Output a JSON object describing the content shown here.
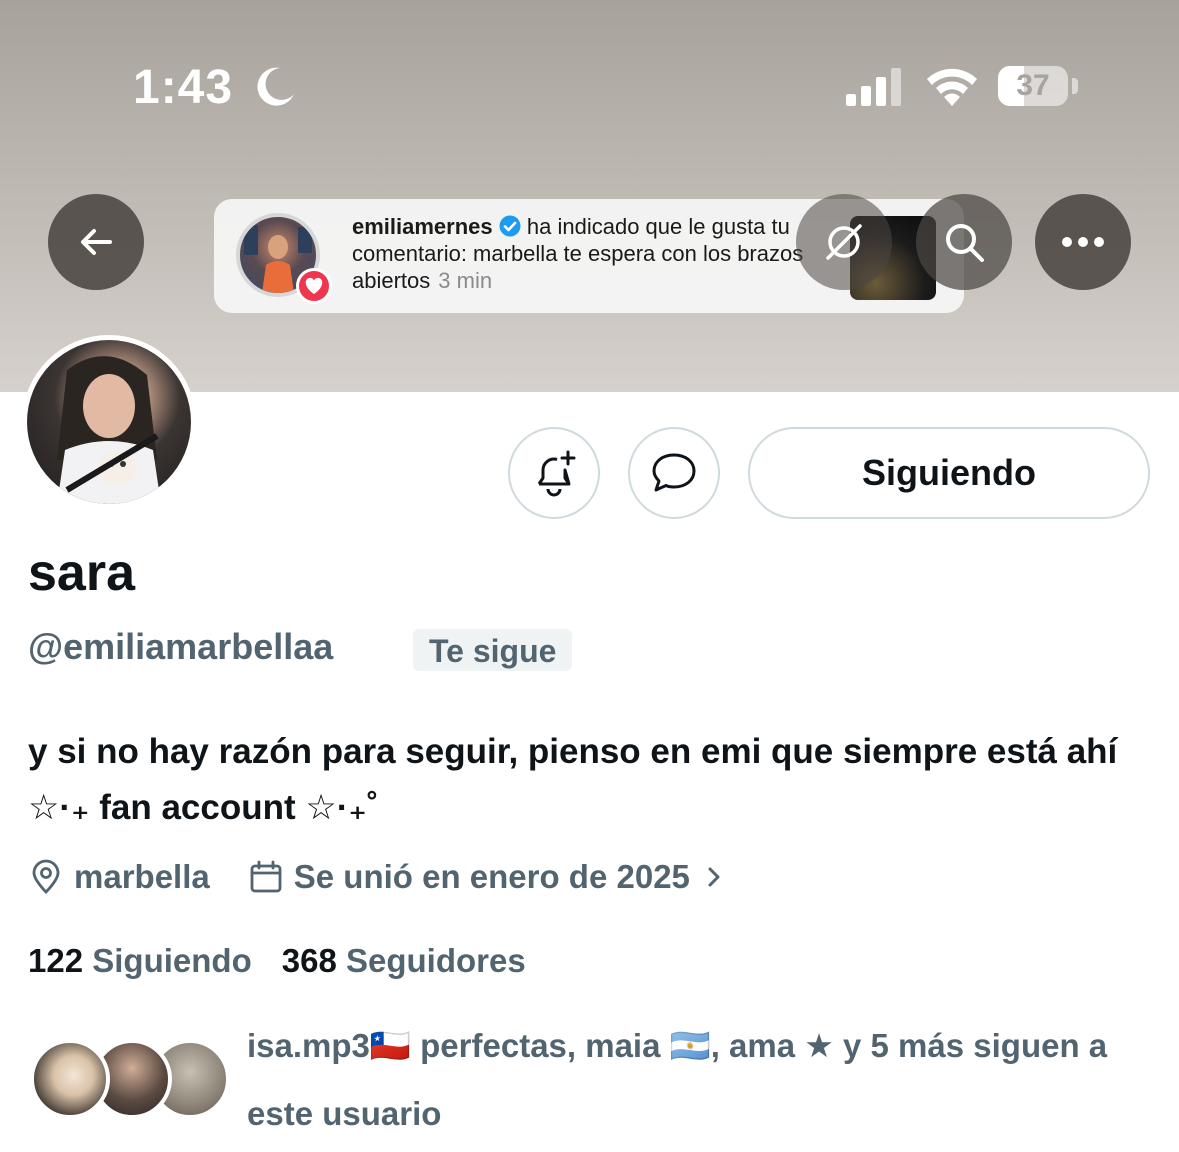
{
  "status_bar": {
    "time": "1:43",
    "battery": "37",
    "battery_fraction": 0.37
  },
  "notification": {
    "username": "emiliamernes",
    "message": "ha indicado que le gusta tu comentario: marbella te espera con los brazos abiertos",
    "time": "3 min"
  },
  "profile": {
    "name": "sara",
    "handle": "@emiliamarbellaa",
    "follows_you_badge": "Te sigue",
    "bio": "y si no hay razón para seguir, pienso en emi que siempre está ahí ☆·₊ fan account ☆·₊˚",
    "location": "marbella",
    "joined": "Se unió en enero de 2025",
    "following_count": "122",
    "following_label": "Siguiendo",
    "followers_count": "368",
    "followers_label": "Seguidores",
    "followed_by": "isa.mp3🇨🇱 perfectas, maia 🇦🇷, ama ★ y 5 más siguen a este usuario"
  },
  "actions": {
    "follow_button": "Siguiendo"
  },
  "colors": {
    "secondary_text": "#536471",
    "border": "#cfd9de",
    "verified": "#1d9bf0",
    "like_heart": "#f0354f"
  },
  "icons": [
    "moon-icon",
    "signal-icon",
    "wifi-icon",
    "battery-icon",
    "back-arrow-icon",
    "grok-icon",
    "search-icon",
    "more-icon",
    "heart-icon",
    "verified-icon",
    "bell-plus-icon",
    "message-icon",
    "location-pin-icon",
    "calendar-icon",
    "chevron-right-icon"
  ]
}
